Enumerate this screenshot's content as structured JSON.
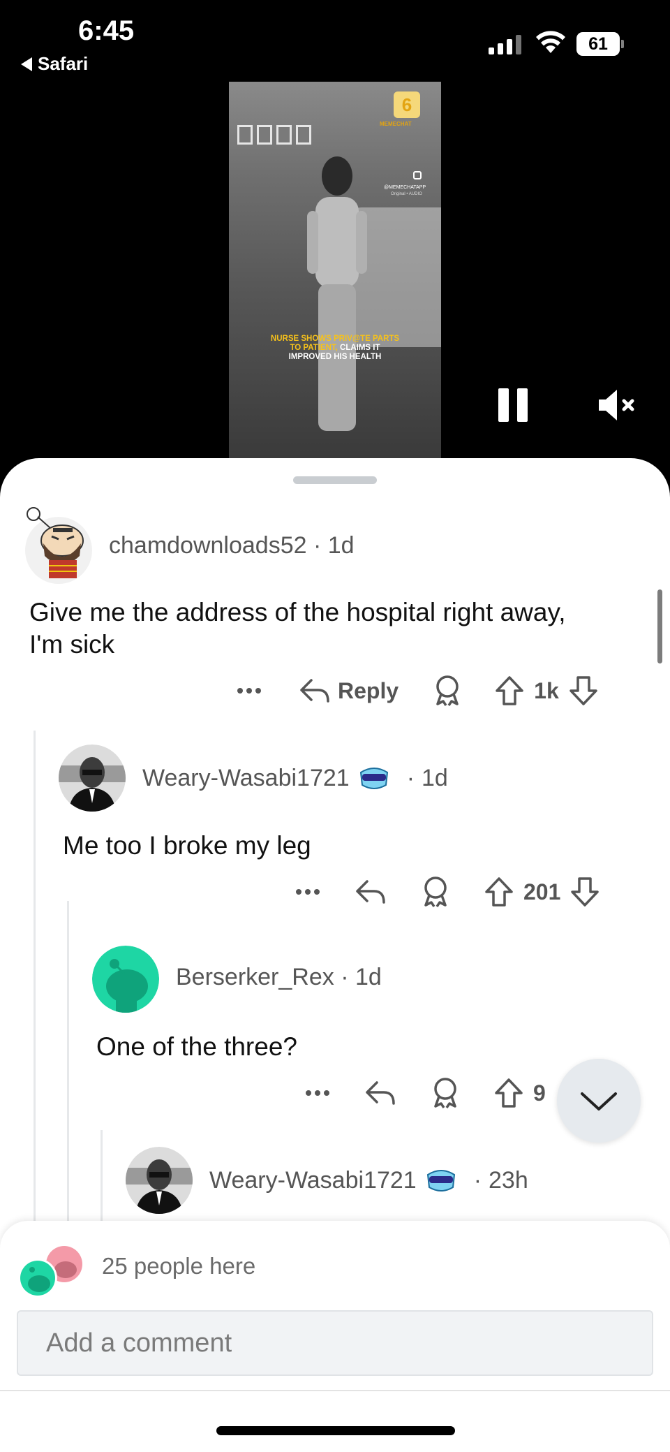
{
  "status_bar": {
    "time": "6:45",
    "back_app": "Safari",
    "battery": "61"
  },
  "video": {
    "brand_logo_text": "MEMECHAT",
    "instagram_handle": "@MEMECHATAPP",
    "handle_sub": "Original • AUDIO",
    "caption_line1": "NURSE SHOWS PRIV@TE PARTS",
    "caption_line2a": "TO PATIENT,",
    "caption_line2b": " CLAIMS IT",
    "caption_line3": "IMPROVED HIS HEALTH"
  },
  "comments": [
    {
      "username": "chamdownloads52",
      "age": "1d",
      "text_line1": "Give me the address of the hospital right away,",
      "text_line2": "I'm sick",
      "reply_label": "Reply",
      "votes": "1k"
    },
    {
      "username": "Weary-Wasabi1721",
      "age": "1d",
      "text": "Me too I broke my leg",
      "votes": "201"
    },
    {
      "username": "Berserker_Rex",
      "age": "1d",
      "text": "One of the three?",
      "votes": "9"
    },
    {
      "username": "Weary-Wasabi1721",
      "age": "23h"
    }
  ],
  "separator": "·",
  "presence": {
    "count_text": "25 people here"
  },
  "composer": {
    "placeholder": "Add a comment"
  },
  "colors": {
    "accent_green": "#1ed6a4",
    "text_primary": "#111111",
    "text_secondary": "#555555",
    "caption_yellow": "#f7c21a"
  }
}
